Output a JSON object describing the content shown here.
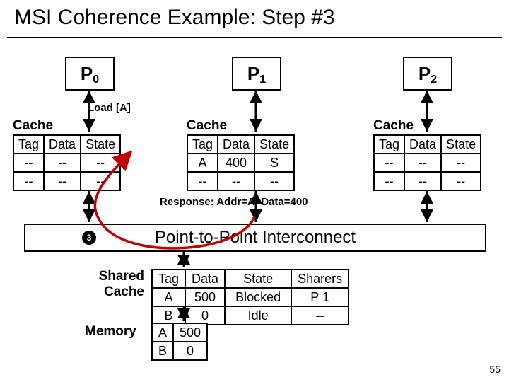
{
  "title": "MSI Coherence Example: Step #3",
  "processors": {
    "p0": "0",
    "p1": "1",
    "p2": "2",
    "P": "P"
  },
  "load_label": "Load [A]",
  "cache_label": "Cache",
  "headers": {
    "tag": "Tag",
    "data": "Data",
    "state": "State",
    "sharers": "Sharers"
  },
  "cache0": {
    "r1": {
      "tag": "--",
      "data": "--",
      "state": "--"
    },
    "r2": {
      "tag": "--",
      "data": "--",
      "state": "--"
    }
  },
  "cache1": {
    "r1": {
      "tag": "A",
      "data": "400",
      "state": "S"
    },
    "r2": {
      "tag": "--",
      "data": "--",
      "state": "--"
    }
  },
  "cache2": {
    "r1": {
      "tag": "--",
      "data": "--",
      "state": "--"
    },
    "r2": {
      "tag": "--",
      "data": "--",
      "state": "--"
    }
  },
  "response_label": "Response: Addr=A, Data=400",
  "interconnect_label": "Point-to-Point Interconnect",
  "step_badge": "3",
  "shared_cache_label_l1": "Shared",
  "shared_cache_label_l2": "Cache",
  "shared": {
    "r1": {
      "tag": "A",
      "data": "500",
      "state": "Blocked",
      "sharers": "P 1"
    },
    "r2": {
      "tag": "B",
      "data": "0",
      "state": "Idle",
      "sharers": "--"
    }
  },
  "memory_label": "Memory",
  "memory": {
    "r1": {
      "tag": "A",
      "data": "500"
    },
    "r2": {
      "tag": "B",
      "data": "0"
    }
  },
  "page_number": "55"
}
